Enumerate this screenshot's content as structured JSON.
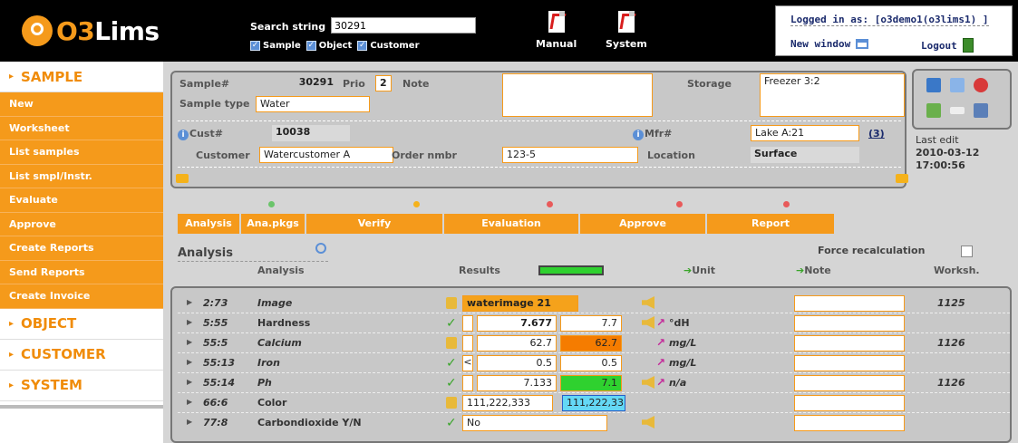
{
  "header": {
    "logo_text": "O3Lims",
    "search_label": "Search string",
    "search_value": "30291",
    "search_opts": [
      "Sample",
      "Object",
      "Customer"
    ],
    "manual_label": "Manual",
    "system_label": "System",
    "logged_in": "Logged in as: [o3demo1(o3lims1) ]",
    "new_window": "New window",
    "logout": "Logout"
  },
  "sidebar": {
    "sample_head": "SAMPLE",
    "items": [
      "New",
      "Worksheet",
      "List samples",
      "List smpl/Instr.",
      "Evaluate",
      "Approve",
      "Create Reports",
      "Send Reports",
      "Create Invoice"
    ],
    "object_head": "OBJECT",
    "customer_head": "CUSTOMER",
    "system_head": "SYSTEM"
  },
  "sample": {
    "sample_label": "Sample#",
    "sample_no": "30291",
    "prio_label": "Prio",
    "prio": "2",
    "note_label": "Note",
    "storage_label": "Storage",
    "storage": "Freezer 3:2",
    "sample_type_label": "Sample type",
    "sample_type": "Water",
    "cust_label": "Cust#",
    "cust_no": "10038",
    "mfr_label": "Mfr#",
    "mfr": "Lake A:21",
    "mfr_count": "(3)",
    "customer_label": "Customer",
    "customer": "Watercustomer A",
    "order_label": "Order nmbr",
    "order": "123-5",
    "location_label": "Location",
    "location": "Surface"
  },
  "last_edit": {
    "label": "Last edit",
    "date": "2010-03-12",
    "time": "17:00:56"
  },
  "steps": [
    "Analysis",
    "Ana.pkgs",
    "Verify",
    "Evaluation",
    "Approve",
    "Report"
  ],
  "analysis": {
    "title": "Analysis",
    "force_label": "Force recalculation",
    "col_analysis": "Analysis",
    "col_results": "Results",
    "col_unit": "Unit",
    "col_note": "Note",
    "col_worksh": "Worksh.",
    "progress": 1.0
  },
  "rows": [
    {
      "id": "2:73",
      "name": "Image",
      "result": "waterimage 21",
      "ws": "1125"
    },
    {
      "id": "5:55",
      "name": "Hardness",
      "result": "7.677",
      "result2": "7.7",
      "unit": "°dH",
      "ws": ""
    },
    {
      "id": "55:5",
      "name": "Calcium",
      "result": "62.7",
      "result2": "62.7",
      "unit": "mg/L",
      "ws": "1126"
    },
    {
      "id": "55:13",
      "name": "Iron",
      "sign": "<",
      "result": "0.5",
      "result2": "0.5",
      "unit": "mg/L",
      "ws": ""
    },
    {
      "id": "55:14",
      "name": "Ph",
      "result": "7.133",
      "result2": "7.1",
      "unit": "n/a",
      "ws": "1126"
    },
    {
      "id": "66:6",
      "name": "Color",
      "result": "111,222,333",
      "result2": "111,222,33",
      "ws": ""
    },
    {
      "id": "77:8",
      "name": "Carbondioxide Y/N",
      "result": "No",
      "ws": ""
    }
  ],
  "colors": {
    "accent": "#f59a1b",
    "calcium_alert": "#f57c00",
    "ph_ok": "#2fd12f",
    "color_swatch": "#64d8f5"
  }
}
